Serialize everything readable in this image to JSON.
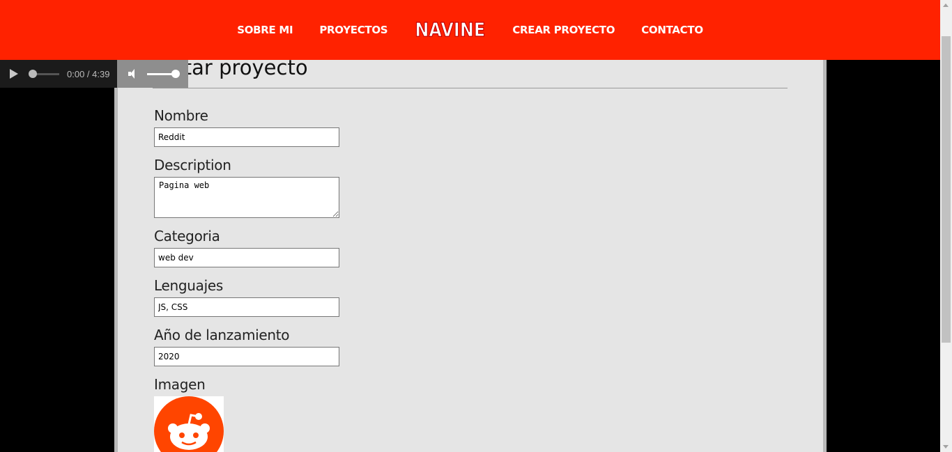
{
  "nav": {
    "links_left": [
      "SOBRE MI",
      "PROYECTOS"
    ],
    "logo": "NAVINE",
    "links_right": [
      "CREAR PROYECTO",
      "CONTACTO"
    ]
  },
  "audio": {
    "time": "0:00 / 4:39"
  },
  "form": {
    "title": "Editar proyecto",
    "nombre_label": "Nombre",
    "nombre_value": "Reddit",
    "description_label": "Description",
    "description_value": "Pagina web",
    "categoria_label": "Categoria",
    "categoria_value": "web dev",
    "lenguajes_label": "Lenguajes",
    "lenguajes_value": "JS, CSS",
    "anio_label": "Año de lanzamiento",
    "anio_value": "2020",
    "imagen_label": "Imagen"
  },
  "colors": {
    "navbar": "#ff2200",
    "reddit_orange": "#ff4500"
  }
}
